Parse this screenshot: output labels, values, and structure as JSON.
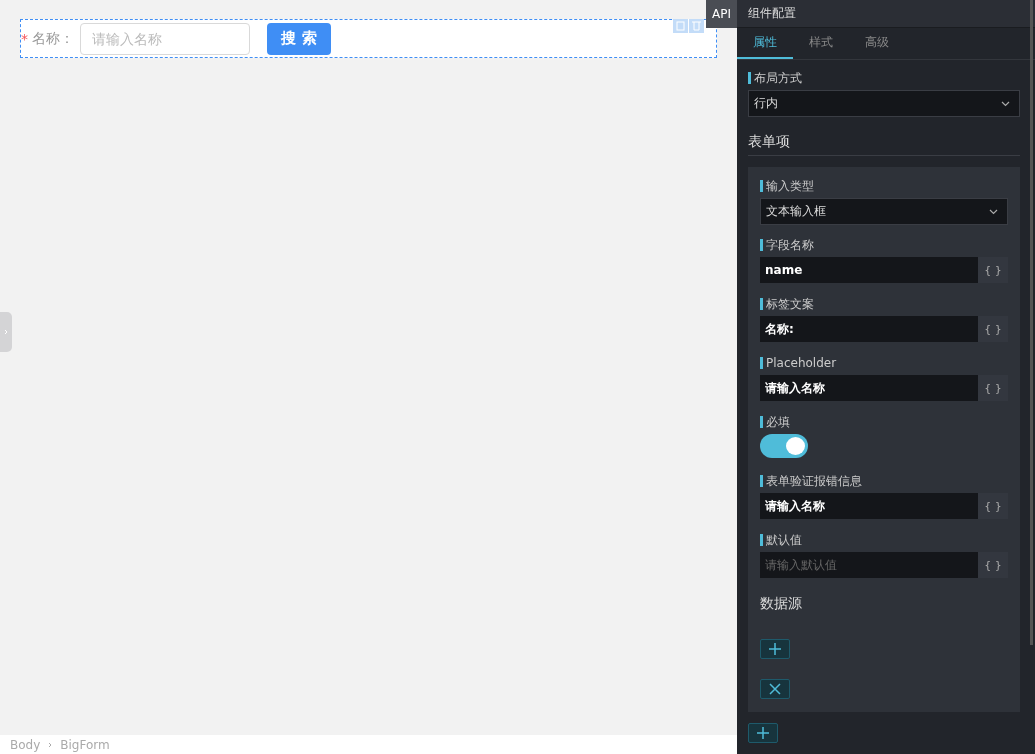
{
  "canvas": {
    "form": {
      "required_mark": "*",
      "label": "名称：",
      "placeholder": "请输入名称",
      "button": "搜 索"
    },
    "breadcrumb": [
      "Body",
      "BigForm"
    ]
  },
  "api_tab": "API",
  "panel": {
    "title": "组件配置",
    "tabs": [
      {
        "label": "属性",
        "selected": true
      },
      {
        "label": "样式",
        "selected": false
      },
      {
        "label": "高级",
        "selected": false
      }
    ],
    "layout": {
      "label": "布局方式",
      "value": "行内"
    },
    "section_title": "表单项",
    "fields": [
      {
        "kind": "select",
        "label": "输入类型",
        "value": "文本输入框"
      },
      {
        "kind": "text",
        "label": "字段名称",
        "value": "name",
        "button": "{ }"
      },
      {
        "kind": "text",
        "label": "标签文案",
        "value": "名称:",
        "button": "{ }"
      },
      {
        "kind": "text",
        "label": "Placeholder",
        "value": "请输入名称",
        "button": "{ }"
      },
      {
        "kind": "toggle",
        "label": "必填",
        "on": true
      },
      {
        "kind": "text",
        "label": "表单验证报错信息",
        "value": "请输入名称",
        "button": "{ }"
      },
      {
        "kind": "text",
        "label": "默认值",
        "placeholder": "请输入默认值",
        "button": "{ }"
      }
    ],
    "datasource_title": "数据源"
  }
}
